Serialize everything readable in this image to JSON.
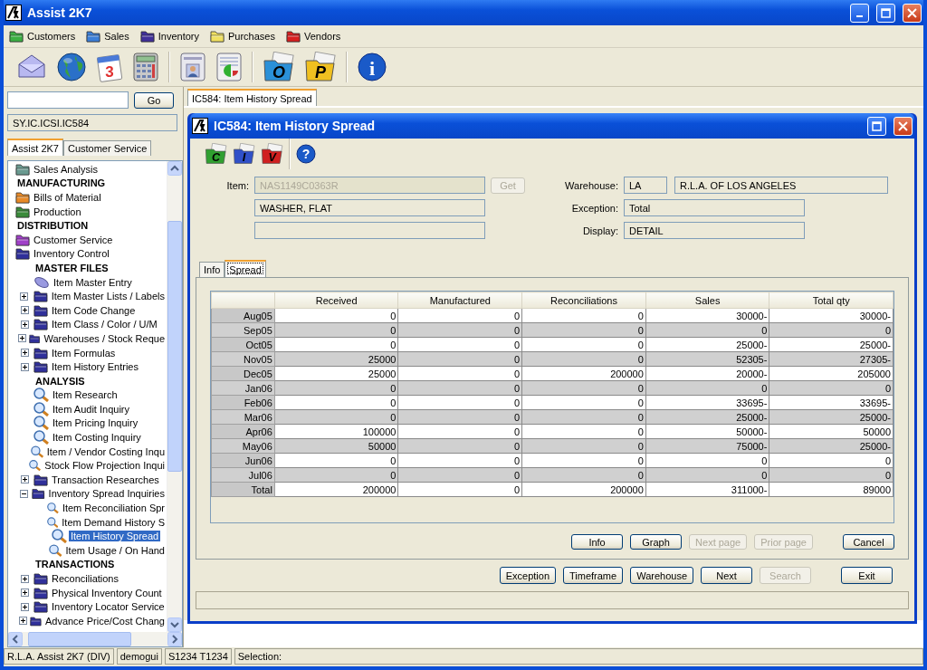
{
  "window": {
    "title": "Assist 2K7"
  },
  "menu": [
    {
      "label": "Customers",
      "color": "#3cb043"
    },
    {
      "label": "Sales",
      "color": "#3c7fd8"
    },
    {
      "label": "Inventory",
      "color": "#40309a"
    },
    {
      "label": "Purchases",
      "color": "#f0e060"
    },
    {
      "label": "Vendors",
      "color": "#d82020"
    }
  ],
  "toolbar": [
    {
      "kind": "envelope"
    },
    {
      "kind": "globe"
    },
    {
      "kind": "calendar",
      "glyph": "3"
    },
    {
      "kind": "calculator"
    },
    {
      "kind": "sep"
    },
    {
      "kind": "card"
    },
    {
      "kind": "chart"
    },
    {
      "kind": "sep"
    },
    {
      "kind": "letterfolder",
      "glyph": "O",
      "color": "#2a90d8"
    },
    {
      "kind": "letterfolder",
      "glyph": "P",
      "color": "#f0c020"
    },
    {
      "kind": "sep"
    },
    {
      "kind": "info",
      "glyph": "i"
    }
  ],
  "sidebar": {
    "search": {
      "button": "Go"
    },
    "path": "SY.IC.ICSI.IC584",
    "tabs": [
      {
        "label": "Assist 2K7",
        "selected": true
      },
      {
        "label": "Customer Service",
        "selected": false
      }
    ],
    "tree": [
      {
        "label": "Sales Analysis",
        "kind": "folder",
        "color": "#6a9a90",
        "selected": false
      },
      {
        "label": "MANUFACTURING",
        "kind": "heading"
      },
      {
        "label": "Bills of Material",
        "kind": "folder",
        "color": "#e88a28",
        "selected": false
      },
      {
        "label": "Production",
        "kind": "folder",
        "color": "#3a8a3a",
        "selected": false
      },
      {
        "label": "DISTRIBUTION",
        "kind": "heading"
      },
      {
        "label": "Customer Service",
        "kind": "folder",
        "color": "#a040c8",
        "selected": false
      },
      {
        "label": "Inventory Control",
        "kind": "folder",
        "color": "#30309a",
        "selected": false,
        "children": [
          {
            "label": "MASTER FILES",
            "kind": "heading"
          },
          {
            "label": "Item Master Entry",
            "kind": "entry",
            "selected": false
          },
          {
            "label": "Item Master Lists / Labels",
            "kind": "folder",
            "color": "#30309a",
            "expanded": false,
            "selected": false
          },
          {
            "label": "Item Code Change",
            "kind": "folder",
            "color": "#30309a",
            "expanded": false,
            "selected": false
          },
          {
            "label": "Item Class / Color / U/M",
            "kind": "folder",
            "color": "#30309a",
            "expanded": false,
            "selected": false
          },
          {
            "label": "Warehouses / Stock Reque",
            "kind": "folder",
            "color": "#30309a",
            "expanded": false,
            "selected": false
          },
          {
            "label": "Item Formulas",
            "kind": "folder",
            "color": "#30309a",
            "expanded": false,
            "selected": false
          },
          {
            "label": "Item History Entries",
            "kind": "folder",
            "color": "#30309a",
            "expanded": false,
            "selected": false
          },
          {
            "label": "ANALYSIS",
            "kind": "heading"
          },
          {
            "label": "Item Research",
            "kind": "inquiry",
            "selected": false
          },
          {
            "label": "Item Audit Inquiry",
            "kind": "inquiry",
            "selected": false
          },
          {
            "label": "Item Pricing Inquiry",
            "kind": "inquiry",
            "selected": false
          },
          {
            "label": "Item Costing Inquiry",
            "kind": "inquiry",
            "selected": false
          },
          {
            "label": "Item / Vendor Costing Inqu",
            "kind": "inquiry",
            "selected": false
          },
          {
            "label": "Stock Flow Projection Inqui",
            "kind": "inquiry",
            "selected": false
          },
          {
            "label": "Transaction Researches",
            "kind": "folder",
            "color": "#30309a",
            "expanded": false,
            "selected": false
          },
          {
            "label": "Inventory Spread Inquiries",
            "kind": "folder",
            "color": "#30309a",
            "expanded": true,
            "selected": false,
            "children": [
              {
                "label": "Item Reconciliation Spr",
                "kind": "inquiry",
                "selected": false
              },
              {
                "label": "Item Demand History S",
                "kind": "inquiry",
                "selected": false
              },
              {
                "label": "Item History Spread",
                "kind": "inquiry",
                "selected": true
              },
              {
                "label": "Item Usage / On Hand",
                "kind": "inquiry",
                "selected": false
              }
            ]
          },
          {
            "label": "TRANSACTIONS",
            "kind": "heading"
          },
          {
            "label": "Reconciliations",
            "kind": "folder",
            "color": "#30309a",
            "expanded": false,
            "selected": false
          },
          {
            "label": "Physical Inventory Count",
            "kind": "folder",
            "color": "#30309a",
            "expanded": false,
            "selected": false
          },
          {
            "label": "Inventory Locator Service",
            "kind": "folder",
            "color": "#30309a",
            "expanded": false,
            "selected": false
          },
          {
            "label": "Advance Price/Cost Chang",
            "kind": "folder",
            "color": "#30309a",
            "expanded": false,
            "selected": false
          }
        ]
      }
    ]
  },
  "doc_tabs": [
    {
      "label": "IC584: Item History Spread",
      "selected": true
    }
  ],
  "dialog": {
    "title": "IC584: Item History Spread",
    "toolbar": [
      {
        "kind": "letterfolder",
        "glyph": "C",
        "color": "#30a030"
      },
      {
        "kind": "letterfolder",
        "glyph": "I",
        "color": "#3050c8"
      },
      {
        "kind": "letterfolder",
        "glyph": "V",
        "color": "#d02020"
      },
      {
        "kind": "sep"
      },
      {
        "kind": "help",
        "glyph": "?"
      }
    ],
    "item": {
      "label": "Item:",
      "value": "NAS1149C0363R",
      "disabled": true,
      "button": "Get",
      "button_disabled": true,
      "description": "WASHER, FLAT"
    },
    "warehouse": {
      "label": "Warehouse:",
      "code": "LA",
      "name": "R.L.A. OF LOS ANGELES"
    },
    "exception": {
      "label": "Exception:",
      "value": "Total"
    },
    "display": {
      "label": "Display:",
      "value": "DETAIL"
    },
    "tabs": [
      {
        "label": "Info",
        "selected": false
      },
      {
        "label": "Spread",
        "selected": true
      }
    ],
    "table": {
      "columns": [
        "Received",
        "Manufactured",
        "Reconciliations",
        "Sales",
        "Total qty"
      ],
      "rows": [
        {
          "label": "Aug05",
          "cells": [
            "0",
            "0",
            "0",
            "30000-",
            "30000-"
          ]
        },
        {
          "label": "Sep05",
          "cells": [
            "0",
            "0",
            "0",
            "0",
            "0"
          ]
        },
        {
          "label": "Oct05",
          "cells": [
            "0",
            "0",
            "0",
            "25000-",
            "25000-"
          ]
        },
        {
          "label": "Nov05",
          "cells": [
            "25000",
            "0",
            "0",
            "52305-",
            "27305-"
          ]
        },
        {
          "label": "Dec05",
          "cells": [
            "25000",
            "0",
            "200000",
            "20000-",
            "205000"
          ]
        },
        {
          "label": "Jan06",
          "cells": [
            "0",
            "0",
            "0",
            "0",
            "0"
          ]
        },
        {
          "label": "Feb06",
          "cells": [
            "0",
            "0",
            "0",
            "33695-",
            "33695-"
          ]
        },
        {
          "label": "Mar06",
          "cells": [
            "0",
            "0",
            "0",
            "25000-",
            "25000-"
          ]
        },
        {
          "label": "Apr06",
          "cells": [
            "100000",
            "0",
            "0",
            "50000-",
            "50000"
          ]
        },
        {
          "label": "May06",
          "cells": [
            "50000",
            "0",
            "0",
            "75000-",
            "25000-"
          ]
        },
        {
          "label": "Jun06",
          "cells": [
            "0",
            "0",
            "0",
            "0",
            "0"
          ]
        },
        {
          "label": "Jul06",
          "cells": [
            "0",
            "0",
            "0",
            "0",
            "0"
          ]
        },
        {
          "label": "Total",
          "cells": [
            "200000",
            "0",
            "200000",
            "311000-",
            "89000"
          ]
        }
      ]
    },
    "panel_buttons": [
      {
        "label": "Info",
        "disabled": false
      },
      {
        "label": "Graph",
        "disabled": false
      },
      {
        "label": "Next page",
        "disabled": true
      },
      {
        "label": "Prior page",
        "disabled": true
      },
      {
        "label": "Cancel",
        "disabled": false
      }
    ],
    "buttons": [
      {
        "label": "Exception",
        "disabled": false
      },
      {
        "label": "Timeframe",
        "disabled": false
      },
      {
        "label": "Warehouse",
        "disabled": false
      },
      {
        "label": "Next",
        "disabled": false
      },
      {
        "label": "Search",
        "disabled": true
      },
      {
        "label": "Exit",
        "disabled": false
      }
    ]
  },
  "status_bar": [
    "R.L.A. Assist 2K7 (DIV)",
    "demogui",
    "S1234 T1234",
    "Selection:"
  ]
}
